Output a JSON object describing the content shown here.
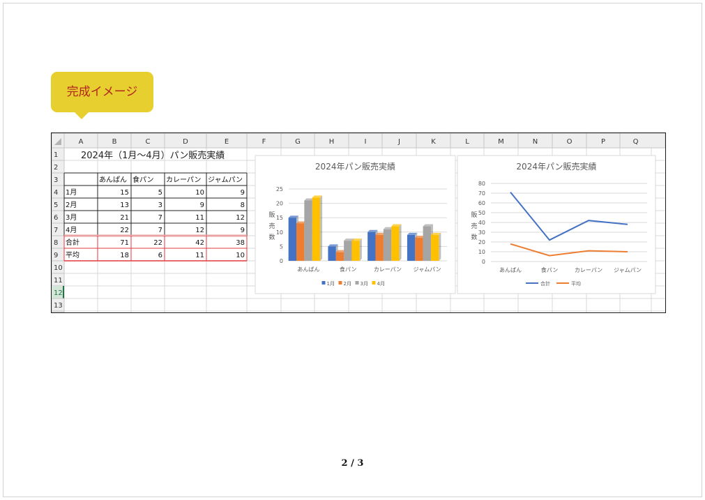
{
  "callout": {
    "text": "完成イメージ"
  },
  "sheet": {
    "columns": [
      "A",
      "B",
      "C",
      "D",
      "E",
      "F",
      "G",
      "H",
      "I",
      "J",
      "K",
      "L",
      "M",
      "N",
      "O",
      "P",
      "Q"
    ],
    "rows": [
      "1",
      "2",
      "3",
      "4",
      "5",
      "6",
      "7",
      "8",
      "9",
      "10",
      "11",
      "12",
      "13"
    ],
    "selected_row": "12",
    "title": "2024年（1月～4月）パン販売実績",
    "table": {
      "headers": [
        "",
        "あんぱん",
        "食パン",
        "カレーパン",
        "ジャムパン"
      ],
      "rows": [
        [
          "1月",
          "15",
          "5",
          "10",
          "9"
        ],
        [
          "2月",
          "13",
          "3",
          "9",
          "8"
        ],
        [
          "3月",
          "21",
          "7",
          "11",
          "12"
        ],
        [
          "4月",
          "22",
          "7",
          "12",
          "9"
        ],
        [
          "合計",
          "71",
          "22",
          "42",
          "38"
        ],
        [
          "平均",
          "18",
          "6",
          "11",
          "10"
        ]
      ]
    }
  },
  "chart_data": [
    {
      "type": "bar",
      "title": "2024年パン販売実績",
      "ylabel": "販売数",
      "categories": [
        "あんぱん",
        "食パン",
        "カレーパン",
        "ジャムパン"
      ],
      "series": [
        {
          "name": "1月",
          "values": [
            15,
            5,
            10,
            9
          ]
        },
        {
          "name": "2月",
          "values": [
            13,
            3,
            9,
            8
          ]
        },
        {
          "name": "3月",
          "values": [
            21,
            7,
            11,
            12
          ]
        },
        {
          "name": "4月",
          "values": [
            22,
            7,
            12,
            9
          ]
        }
      ],
      "ylim": [
        0,
        25
      ],
      "yticks": [
        "0",
        "5",
        "10",
        "15",
        "20",
        "25"
      ],
      "colors": [
        "#4472c4",
        "#ed7d31",
        "#a5a5a5",
        "#ffc000"
      ],
      "grid": true,
      "legend": "bottom"
    },
    {
      "type": "line",
      "title": "2024年パン販売実績",
      "ylabel": "販売数",
      "categories": [
        "あんぱん",
        "食パン",
        "カレーパン",
        "ジャムパン"
      ],
      "series": [
        {
          "name": "合計",
          "values": [
            71,
            22,
            42,
            38
          ]
        },
        {
          "name": "平均",
          "values": [
            18,
            6,
            11,
            10
          ]
        }
      ],
      "ylim": [
        0,
        80
      ],
      "yticks": [
        "0",
        "10",
        "20",
        "30",
        "40",
        "50",
        "60",
        "70",
        "80"
      ],
      "colors": [
        "#4472c4",
        "#ed7d31"
      ],
      "grid": true,
      "legend": "bottom"
    }
  ],
  "footer": {
    "page_number": "2 / 3"
  }
}
